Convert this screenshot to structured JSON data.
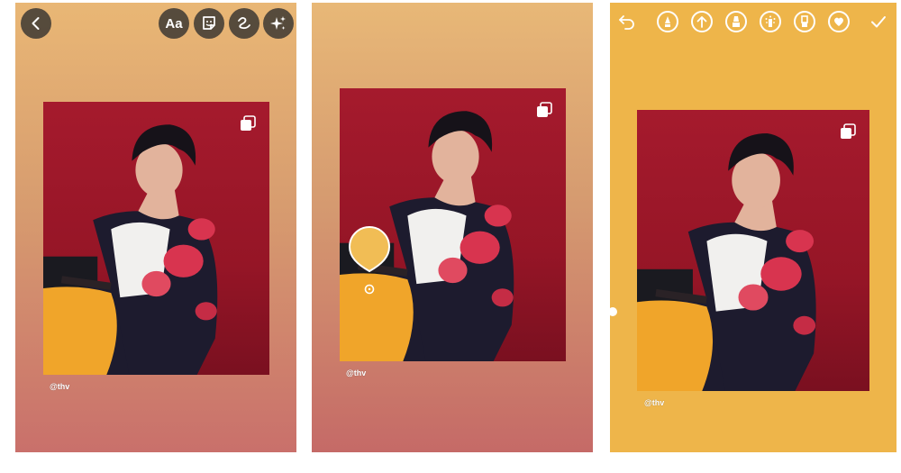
{
  "panels": {
    "story_edit": {
      "caption": "@thv",
      "toolbar": {
        "back_icon": "chevron-left-icon",
        "text_label": "Aa",
        "sticker_icon": "sticker-icon",
        "draw_icon": "squiggle-draw-icon",
        "effects_icon": "sparkles-icon"
      }
    },
    "color_pick": {
      "caption": "@thv",
      "picked_color": "#f1bd55"
    },
    "draw_mode": {
      "caption": "@thv",
      "background_color": "#eeb54a",
      "tools": [
        "undo-icon",
        "pen-icon",
        "arrow-up-icon",
        "marker-icon",
        "neon-icon",
        "eraser-icon",
        "heart-brush-icon",
        "checkmark-icon"
      ]
    }
  },
  "colors": {
    "photo_bg": "#a51a2d",
    "jacket": "#1d1b2e",
    "flower": "#d8344f",
    "pants": "#f0a52a",
    "shirt": "#f1f0ee",
    "skin": "#e2b39c",
    "hair": "#161219"
  }
}
